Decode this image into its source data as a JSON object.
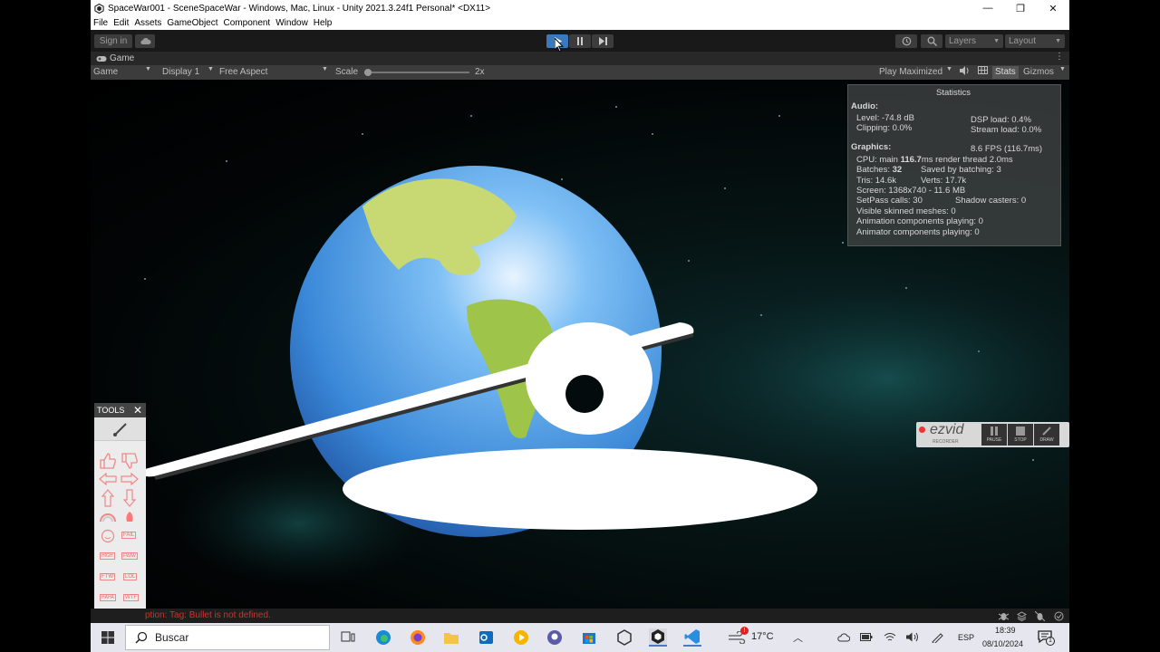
{
  "window": {
    "title": "SpaceWar001 - SceneSpaceWar - Windows, Mac, Linux - Unity 2021.3.24f1 Personal* <DX11>",
    "minimize": "—",
    "maximize": "❐",
    "close": "✕"
  },
  "menu": [
    "File",
    "Edit",
    "Assets",
    "GameObject",
    "Component",
    "Window",
    "Help"
  ],
  "toolbar": {
    "sign_in": "Sign in",
    "layers": "Layers",
    "layout": "Layout"
  },
  "game_tab": {
    "label": "Game"
  },
  "game_controls": {
    "mode": "Game",
    "display": "Display 1",
    "aspect": "Free Aspect",
    "scale_label": "Scale",
    "scale_value": "2x",
    "play_maximized": "Play Maximized",
    "stats": "Stats",
    "gizmos": "Gizmos"
  },
  "statistics": {
    "title": "Statistics",
    "audio_header": "Audio:",
    "level": "Level: -74.8 dB",
    "clipping": "Clipping: 0.0%",
    "dsp_load": "DSP load: 0.4%",
    "stream_load": "Stream load: 0.0%",
    "graphics_header": "Graphics:",
    "fps": "8.6 FPS (116.7ms)",
    "cpu_prefix": "CPU: main ",
    "cpu_main": "116.7",
    "cpu_suffix": "ms  render thread 2.0ms",
    "batches_prefix": "Batches: ",
    "batches_value": "32",
    "saved_by_batching": "Saved by batching: 3",
    "tris": "Tris: 14.6k",
    "verts": "Verts: 17.7k",
    "screen": "Screen: 1368x740 - 11.6 MB",
    "setpass": "SetPass calls: 30",
    "shadow_casters": "Shadow casters: 0",
    "skinned": "Visible skinned meshes: 0",
    "animation": "Animation components playing: 0",
    "animator": "Animator components playing: 0"
  },
  "tools_panel": {
    "title": "TOOLS",
    "stamps": [
      "IN",
      "FAIL",
      "HIGH",
      "FWIW",
      "FTW",
      "LOL",
      "HAHA",
      "WTF"
    ]
  },
  "recorder": {
    "brand": "ezvid",
    "sub": "RECORDER",
    "pause": "PAUSE",
    "stop": "STOP",
    "draw": "DRAW"
  },
  "console": {
    "message": "ption: Tag: Bullet is not defined."
  },
  "taskbar": {
    "search_placeholder": "Buscar",
    "temperature": "17°C",
    "lang": "ESP",
    "time": "18:39",
    "date": "08/10/2024",
    "notif_count": "1"
  },
  "colors": {
    "unity_bg": "#1e1e1e",
    "play_active": "#3a79bb",
    "ocean": "#3d8fe0",
    "land": "#b9d36b"
  }
}
